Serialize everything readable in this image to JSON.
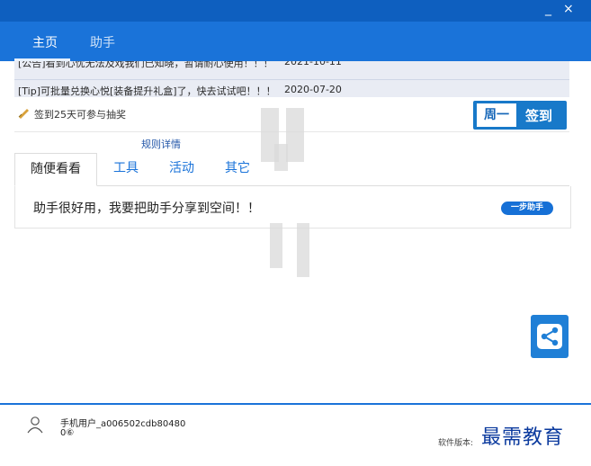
{
  "window": {
    "minimize_glyph": "_",
    "close_glyph": "×"
  },
  "nav": {
    "tabs": [
      {
        "label": "主页",
        "active": true
      },
      {
        "label": "助手",
        "active": false
      }
    ]
  },
  "notices": [
    {
      "text": "[公告]看到心忧无法及戏我们已知晓，暂请耐心使用！！！",
      "date": "2021-10-11"
    },
    {
      "text": "[Tip]可批量兑换心悦[装备提升礼盒]了，快去试试吧！！！",
      "date": "2020-07-20"
    }
  ],
  "checkin": {
    "tip": "签到25天可参与抽奖",
    "weekday": "周一",
    "button_label": "签到",
    "rules_link": "规则详情"
  },
  "tabs": [
    {
      "label": "随便看看",
      "active": true
    },
    {
      "label": "工具"
    },
    {
      "label": "活动"
    },
    {
      "label": "其它"
    }
  ],
  "content": {
    "message": "助手很好用，我要把助手分享到空间！！",
    "badge": "一步助手"
  },
  "share": {
    "icon": "share-icon"
  },
  "footer": {
    "username": "手机用户_a006502cdb80480",
    "points": "0⑥",
    "version_label": "软件版本:",
    "brand": "最需教育"
  },
  "colors": {
    "primary": "#1a73d9",
    "titlebar": "#0e5fbf",
    "brand": "#0b3a9e"
  }
}
